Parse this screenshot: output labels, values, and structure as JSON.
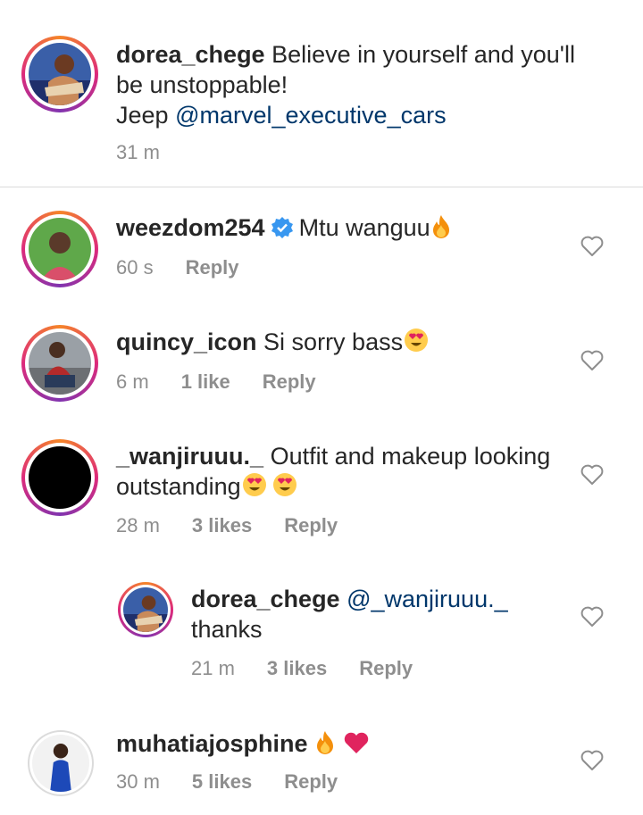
{
  "caption": {
    "username": "dorea_chege",
    "text_line1": "Believe in yourself and you'll",
    "text_line2": "be unstoppable!",
    "text_line3_prefix": "Jeep ",
    "mention": "@marvel_executive_cars",
    "time": "31 m"
  },
  "comments": [
    {
      "username": "weezdom254",
      "text": "Mtu wanguu",
      "time": "60 s",
      "likes": "",
      "reply": "Reply",
      "emoji": "fire-emoji",
      "verified": true
    },
    {
      "username": "quincy_icon",
      "text": "Si sorry bass",
      "time": "6 m",
      "likes": "1 like",
      "reply": "Reply",
      "emoji": "heart-eyes-emoji"
    },
    {
      "username": "_wanjiruuu._",
      "text_line1": "Outfit and makeup looking",
      "text_line2": "outstanding",
      "time": "28 m",
      "likes": "3 likes",
      "reply": "Reply",
      "emoji": "heart-eyes-emoji"
    },
    {
      "username": "dorea_chege",
      "mention": "@_wanjiruuu._",
      "text_line2": "thanks",
      "time": "21 m",
      "likes": "3 likes",
      "reply": "Reply",
      "is_reply": true
    },
    {
      "username": "muhatiajosphine",
      "text": "",
      "time": "30 m",
      "likes": "5 likes",
      "reply": "Reply",
      "emoji": "fire-and-heart-emoji"
    }
  ],
  "colors": {
    "text": "#262626",
    "meta": "#8e8e8e",
    "mention": "#00376b",
    "verified": "#3897f0",
    "heart": "#ed4956"
  }
}
